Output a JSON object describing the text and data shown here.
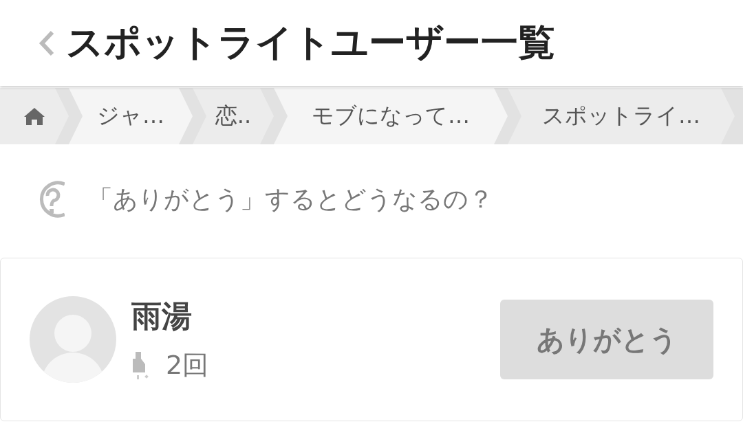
{
  "header": {
    "title": "スポットライトユーザー一覧"
  },
  "breadcrumbs": [
    {
      "label": "ジャ…"
    },
    {
      "label": "恋.."
    },
    {
      "label": "モブになって…"
    },
    {
      "label": "スポットライ…"
    }
  ],
  "help_link": {
    "text": "「ありがとう」するとどうなるの？"
  },
  "users": [
    {
      "name": "雨湯",
      "count": "2回",
      "button": "ありがとう"
    }
  ]
}
